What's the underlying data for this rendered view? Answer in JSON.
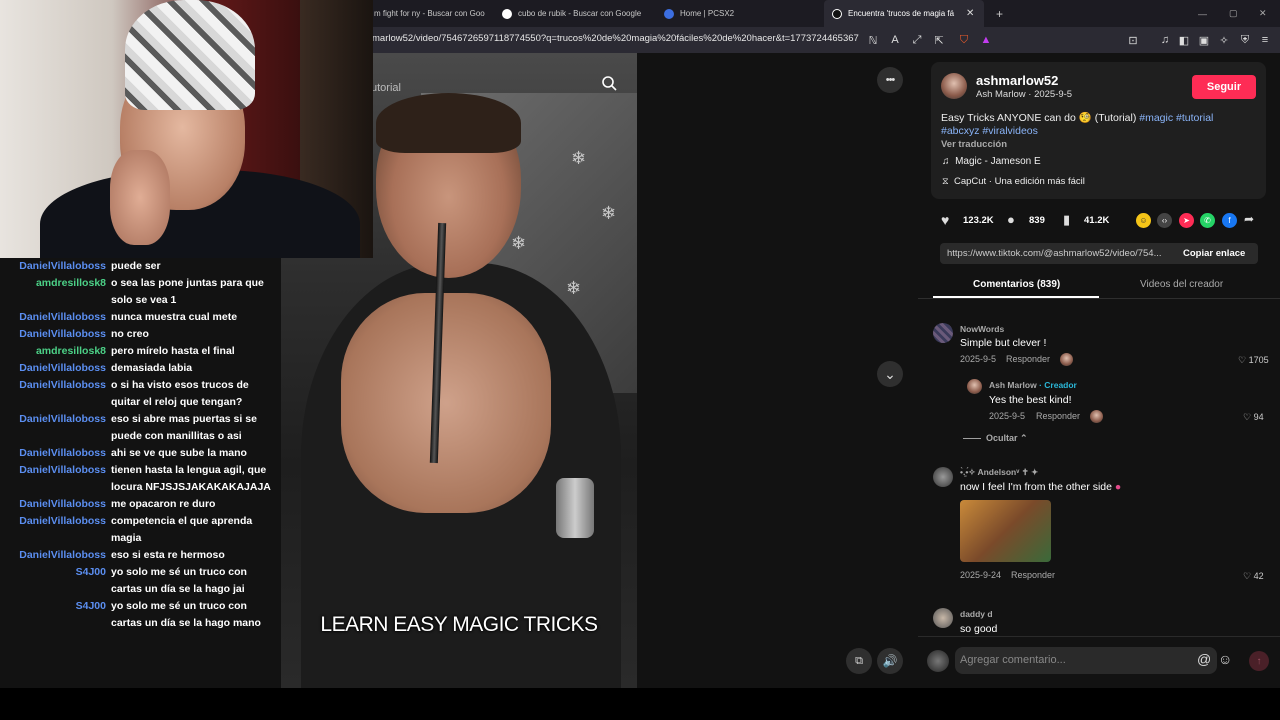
{
  "browser": {
    "tabs": [
      {
        "label": "m fight for ny - Buscar con Goo"
      },
      {
        "label": "cubo de rubik - Buscar con Google"
      },
      {
        "label": "Home | PCSX2"
      },
      {
        "label": "Encuentra 'trucos de magia fá"
      }
    ],
    "new_tab": "+",
    "url": "marlow52/video/7546726597118774550?q=trucos%20de%20magia%20fáciles%20de%20hacer&t=1773724465367"
  },
  "video": {
    "search_text": "utorial",
    "subtitle": "LEARN EASY MAGIC TRICKS",
    "more_icon": "•••",
    "down_icon": "⌄",
    "sound_icon": "🔊"
  },
  "chat": [
    {
      "user": "DanielVillaloboss",
      "color": "#5b8ef0",
      "msg": "puede ser"
    },
    {
      "user": "amdresillosk8",
      "color": "#4cd187",
      "msg": "o sea las pone juntas para que solo se vea 1"
    },
    {
      "user": "DanielVillaloboss",
      "color": "#5b8ef0",
      "msg": "nunca muestra cual mete"
    },
    {
      "user": "DanielVillaloboss",
      "color": "#5b8ef0",
      "msg": "no creo"
    },
    {
      "user": "amdresillosk8",
      "color": "#4cd187",
      "msg": "pero mírelo hasta el final"
    },
    {
      "user": "DanielVillaloboss",
      "color": "#5b8ef0",
      "msg": "demasiada labia"
    },
    {
      "user": "DanielVillaloboss",
      "color": "#5b8ef0",
      "msg": "o si ha visto esos trucos de quitar el reloj que tengan?"
    },
    {
      "user": "DanielVillaloboss",
      "color": "#5b8ef0",
      "msg": "eso si abre mas puertas si se puede con manillitas o asi"
    },
    {
      "user": "DanielVillaloboss",
      "color": "#5b8ef0",
      "msg": "ahi se ve que sube la mano"
    },
    {
      "user": "DanielVillaloboss",
      "color": "#5b8ef0",
      "msg": "tienen hasta la lengua agil, que locura NFJSJSJAKAKAKAJAJA"
    },
    {
      "user": "DanielVillaloboss",
      "color": "#5b8ef0",
      "msg": "me opacaron re duro"
    },
    {
      "user": "DanielVillaloboss",
      "color": "#5b8ef0",
      "msg": "competencia el que aprenda magia"
    },
    {
      "user": "DanielVillaloboss",
      "color": "#5b8ef0",
      "msg": "eso si esta re hermoso"
    },
    {
      "user": "S4J00",
      "color": "#5b8ef0",
      "msg": "yo solo me sé un truco con cartas un día se la hago jai"
    },
    {
      "user": "S4J00",
      "color": "#5b8ef0",
      "msg": "yo solo me sé un truco con cartas un día se la hago mano"
    }
  ],
  "post": {
    "username": "ashmarlow52",
    "display": "Ash Marlow · 2025-9-5",
    "follow": "Seguir",
    "caption_plain": "Easy Tricks ANYONE can do 🧐 (Tutorial)",
    "caption_tags1": "#magic #tutorial",
    "caption_tags2": "#abcxyz #viralvideos",
    "translate": "Ver traducción",
    "music": "Magic - Jameson  E",
    "capcut": "CapCut · Una edición más fácil",
    "likes": "123.2K",
    "comments_count": "839",
    "saves": "41.2K",
    "link": "https://www.tiktok.com/@ashmarlow52/video/754...",
    "copy_link": "Copiar enlace"
  },
  "tabs": {
    "comments": "Comentarios (839)",
    "creator": "Videos del creador"
  },
  "comments": {
    "c1_user": "NowWords",
    "c1_text": "Simple but clever !",
    "c1_date": "2025-9-5",
    "c1_reply": "Responder",
    "c1_likes": "1705",
    "r1_user": "Ash Marlow",
    "r1_badge": "· Creador",
    "r1_text": "Yes the best kind!",
    "r1_date": "2025-9-5",
    "r1_reply": "Responder",
    "r1_likes": "94",
    "hide": "Ocultar",
    "c2_user": "•̀.̫•́✧ Andelsonᵛ ✝︎ ✦",
    "c2_text": "now I feel I'm from the other side",
    "c2_date": "2025-9-24",
    "c2_reply": "Responder",
    "c2_likes": "42",
    "c3_user": "daddy d",
    "c3_text": "so good",
    "input_placeholder": "Agregar comentario..."
  }
}
